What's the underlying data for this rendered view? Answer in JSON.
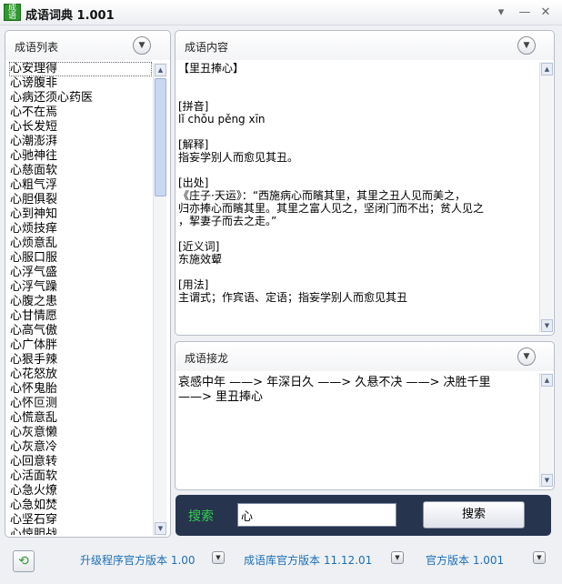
{
  "window": {
    "icon_text": "成语",
    "title": "成语词典  1.001",
    "controls": {
      "menu": "▾",
      "minimize": "—",
      "close": "✕"
    }
  },
  "list_panel": {
    "title": "成语列表",
    "items": [
      "心安理得",
      "心谤腹非",
      "心病还须心药医",
      "心不在焉",
      "心长发短",
      "心潮澎湃",
      "心驰神往",
      "心慈面软",
      "心粗气浮",
      "心胆俱裂",
      "心到神知",
      "心烦技痒",
      "心烦意乱",
      "心服口服",
      "心浮气盛",
      "心浮气躁",
      "心腹之患",
      "心甘情愿",
      "心高气傲",
      "心广体胖",
      "心狠手辣",
      "心花怒放",
      "心怀鬼胎",
      "心怀叵测",
      "心慌意乱",
      "心灰意懒",
      "心灰意冷",
      "心回意转",
      "心活面软",
      "心急火燎",
      "心急如焚",
      "心坚石穿",
      "心惊胆战"
    ],
    "selected_index": 0
  },
  "content_panel": {
    "title": "成语内容",
    "lines": [
      {
        "text": "【里丑捧心】",
        "gap": false
      },
      {
        "text": "",
        "gap": false
      },
      {
        "text": "[拼音]",
        "gap": true
      },
      {
        "text": "lǐ  chǒu  pěng  xīn",
        "gap": false
      },
      {
        "text": "[解释]",
        "gap": true
      },
      {
        "text": "指妄学别人而愈见其丑。",
        "gap": false
      },
      {
        "text": "[出处]",
        "gap": true
      },
      {
        "text": "《庄子·天运》：“西施病心而矉其里，其里之丑人见而美之，",
        "gap": false
      },
      {
        "text": "归亦捧心而矉其里。其里之富人见之，坚闭门而不出；贫人见之",
        "gap": false
      },
      {
        "text": "，挈妻子而去之走。”",
        "gap": false
      },
      {
        "text": "[近义词]",
        "gap": true
      },
      {
        "text": "东施效颦",
        "gap": false
      },
      {
        "text": "[用法]",
        "gap": true
      },
      {
        "text": "主谓式；作宾语、定语；指妄学别人而愈见其丑",
        "gap": false
      }
    ]
  },
  "chain_panel": {
    "title": "成语接龙",
    "lines": [
      "哀感中年 ——> 年深日久 ——> 久悬不决 ——> 决胜千里",
      "——> 里丑捧心"
    ]
  },
  "search": {
    "label": "搜索",
    "value": "心",
    "button": "搜索"
  },
  "footer": {
    "refresh_icon": "⟲",
    "upgrade_link": "升级程序官方版本 1.00",
    "db_link": "成语库官方版本 11.12.01",
    "official_link": "官方版本 1.001"
  },
  "colors": {
    "search_bar_bg": "#27344e",
    "search_label": "#2fd14f",
    "footer_link": "#1c6fb4"
  }
}
